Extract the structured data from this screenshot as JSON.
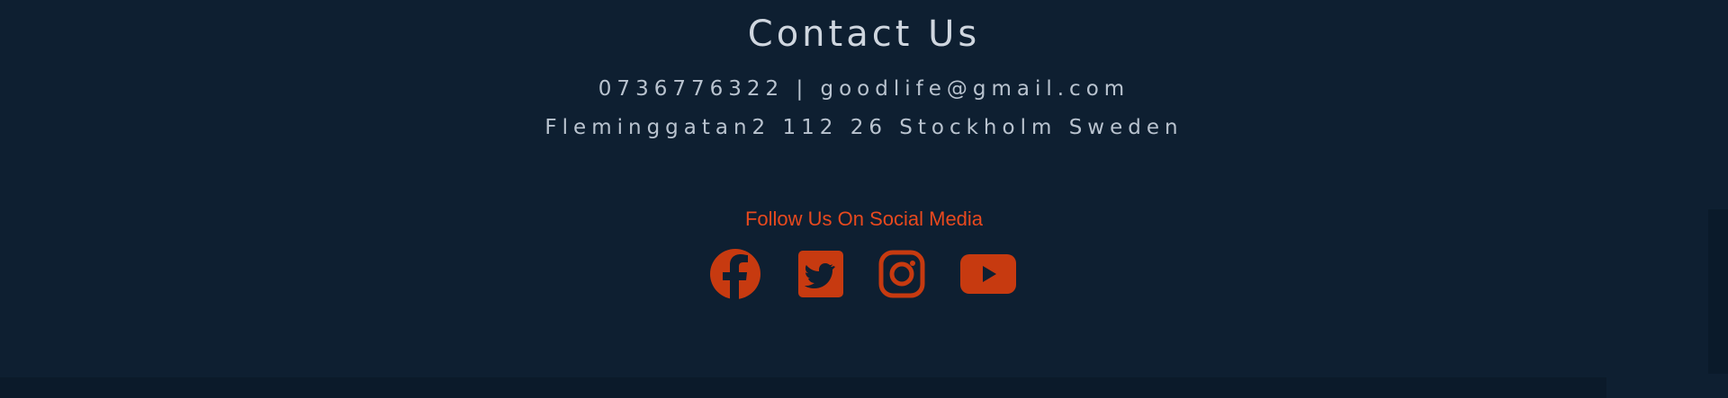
{
  "contact": {
    "title": "Contact Us",
    "phone_email": "0736776322 | goodlife@gmail.com",
    "address": "Fleminggatan2 112 26 Stockholm Sweden"
  },
  "social": {
    "title": "Follow Us On Social Media",
    "icons": [
      {
        "name": "facebook-icon"
      },
      {
        "name": "twitter-icon"
      },
      {
        "name": "instagram-icon"
      },
      {
        "name": "youtube-icon"
      }
    ]
  },
  "colors": {
    "background": "#0e1f31",
    "heading": "#cfd6df",
    "body_text": "#b9c3cf",
    "accent": "#e8491e",
    "icon": "#c73a10"
  }
}
